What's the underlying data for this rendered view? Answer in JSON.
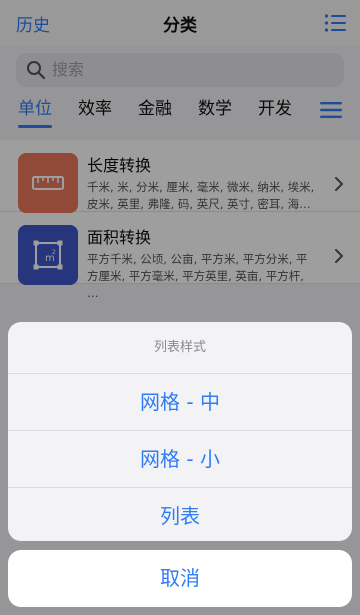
{
  "nav": {
    "left_label": "历史",
    "title": "分类",
    "right_icon": "list-icon"
  },
  "search": {
    "placeholder": "搜索"
  },
  "tabs": [
    {
      "label": "单位",
      "active": true
    },
    {
      "label": "效率",
      "active": false
    },
    {
      "label": "金融",
      "active": false
    },
    {
      "label": "数学",
      "active": false
    },
    {
      "label": "开发",
      "active": false
    }
  ],
  "list": {
    "items": [
      {
        "title": "长度转换",
        "desc": "千米, 米, 分米, 厘米, 毫米, 微米, 纳米, 埃米, 皮米, 英里, 弗隆, 码, 英尺, 英寸, 密耳, 海…",
        "icon": "ruler-icon",
        "color": "#e9785a"
      },
      {
        "title": "面积转换",
        "desc": "平方千米, 公顷, 公亩, 平方米, 平方分米, 平方厘米, 平方毫米, 平方英里, 英亩, 平方杆, …",
        "icon": "area-icon",
        "color": "#3f57c8"
      }
    ]
  },
  "sheet": {
    "title": "列表样式",
    "options": [
      "网格 - 中",
      "网格 - 小",
      "列表"
    ],
    "cancel": "取消"
  },
  "colors": {
    "accent": "#2f7cf6"
  }
}
